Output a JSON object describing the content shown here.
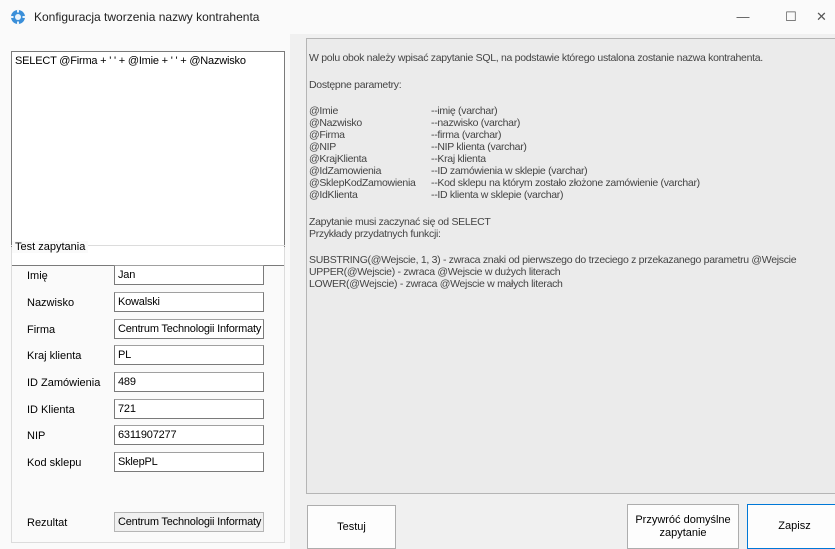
{
  "window": {
    "title": "Konfiguracja tworzenia nazwy kontrahenta",
    "minimize": "—",
    "maximize": "☐",
    "close": "✕"
  },
  "sql_query": "SELECT @Firma + ' ' + @Imie + ' ' + @Nazwisko",
  "test_group": {
    "legend": "Test zapytania",
    "fields": [
      {
        "label": "Imię",
        "value": "Jan"
      },
      {
        "label": "Nazwisko",
        "value": "Kowalski"
      },
      {
        "label": "Firma",
        "value": "Centrum Technologii Informaty"
      },
      {
        "label": "Kraj klienta",
        "value": "PL"
      },
      {
        "label": "ID Zamówienia",
        "value": "489"
      },
      {
        "label": "ID Klienta",
        "value": "721"
      },
      {
        "label": "NIP",
        "value": "6311907277"
      },
      {
        "label": "Kod sklepu",
        "value": "SklepPL"
      }
    ],
    "result_label": "Rezultat",
    "result_value": "Centrum Technologii Informaty"
  },
  "info": {
    "intro": "W polu obok należy wpisać zapytanie SQL, na podstawie którego ustalona zostanie nazwa kontrahenta.",
    "params_header": "Dostępne parametry:",
    "params": [
      {
        "name": "@Imie",
        "desc": "--imię (varchar)"
      },
      {
        "name": "@Nazwisko",
        "desc": "--nazwisko (varchar)"
      },
      {
        "name": "@Firma",
        "desc": "--firma (varchar)"
      },
      {
        "name": "@NIP",
        "desc": "--NIP klienta (varchar)"
      },
      {
        "name": "@KrajKlienta",
        "desc": "--Kraj klienta"
      },
      {
        "name": "@IdZamowienia",
        "desc": "--ID zamówienia w sklepie (varchar)"
      },
      {
        "name": "@SklepKodZamowienia",
        "desc": "--Kod sklepu na którym zostało złożone zamówienie (varchar)"
      },
      {
        "name": "@IdKlienta",
        "desc": "--ID klienta w sklepie (varchar)"
      }
    ],
    "must_start": "Zapytanie musi zaczynać się od SELECT",
    "examples_header": "Przykłady przydatnych funkcji:",
    "examples": [
      "SUBSTRING(@Wejscie, 1, 3) - zwraca znaki od pierwszego do trzeciego z przekazanego parametru @Wejscie",
      "UPPER(@Wejscie) - zwraca @Wejscie w dużych literach",
      "LOWER(@Wejscie) - zwraca @Wejscie w małych literach"
    ]
  },
  "buttons": {
    "test": "Testuj",
    "restore_line1": "Przywróć domyślne",
    "restore_line2": "zapytanie",
    "save": "Zapisz"
  }
}
